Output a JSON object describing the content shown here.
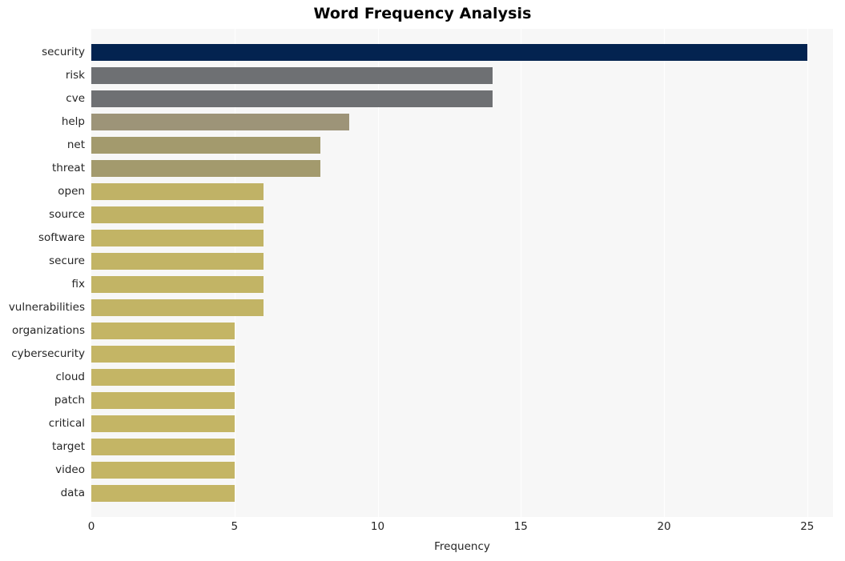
{
  "chart_data": {
    "type": "bar",
    "orientation": "horizontal",
    "title": "Word Frequency Analysis",
    "xlabel": "Frequency",
    "ylabel": "",
    "xlim": [
      0,
      25.9
    ],
    "xticks": [
      0,
      5,
      10,
      15,
      20,
      25
    ],
    "xtick_labels": [
      "0",
      "5",
      "10",
      "15",
      "20",
      "25"
    ],
    "grid": "vertical-only",
    "legend": "none",
    "plot_background": "#f7f7f7",
    "gridline_color": "#ffffff",
    "figure_background": "#ffffff",
    "title_color": "#000000",
    "tick_color": "#262626",
    "categories": [
      "security",
      "risk",
      "cve",
      "help",
      "net",
      "threat",
      "open",
      "source",
      "software",
      "secure",
      "fix",
      "vulnerabilities",
      "organizations",
      "cybersecurity",
      "cloud",
      "patch",
      "critical",
      "target",
      "video",
      "data"
    ],
    "values": [
      25,
      14,
      14,
      9,
      8,
      8,
      6,
      6,
      6,
      6,
      6,
      6,
      5,
      5,
      5,
      5,
      5,
      5,
      5,
      5
    ],
    "bar_colors": [
      "#032350",
      "#6e7073",
      "#6e7073",
      "#9d9478",
      "#a39a6d",
      "#a39a6d",
      "#c0b266",
      "#c0b265",
      "#c2b465",
      "#c2b465",
      "#c2b465",
      "#c2b465",
      "#c4b565",
      "#c4b565",
      "#c4b565",
      "#c4b565",
      "#c4b565",
      "#c4b565",
      "#c4b565",
      "#c4b565"
    ]
  }
}
